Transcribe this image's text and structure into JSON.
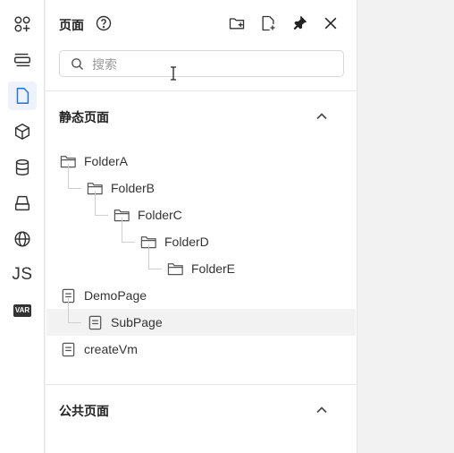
{
  "panel": {
    "title": "页面",
    "header_icons": [
      "help-circle-icon",
      "new-folder-icon",
      "new-page-icon",
      "pin-icon",
      "close-icon"
    ]
  },
  "search": {
    "placeholder": "搜索",
    "value": ""
  },
  "sections": {
    "static": {
      "title": "静态页面",
      "expanded": true
    },
    "public": {
      "title": "公共页面",
      "expanded": true
    }
  },
  "tree": [
    {
      "label": "FolderA",
      "type": "folder",
      "depth": 0
    },
    {
      "label": "FolderB",
      "type": "folder",
      "depth": 1
    },
    {
      "label": "FolderC",
      "type": "folder",
      "depth": 2
    },
    {
      "label": "FolderD",
      "type": "folder",
      "depth": 3
    },
    {
      "label": "FolderE",
      "type": "folder",
      "depth": 4
    },
    {
      "label": "DemoPage",
      "type": "page",
      "depth": 0
    },
    {
      "label": "SubPage",
      "type": "page",
      "depth": 1,
      "highlighted": true
    },
    {
      "label": "createVm",
      "type": "page",
      "depth": 0
    }
  ],
  "rail": [
    {
      "icon": "components-icon",
      "active": false
    },
    {
      "icon": "outline-tree-icon",
      "active": false
    },
    {
      "icon": "page-icon",
      "active": true
    },
    {
      "icon": "cube-icon",
      "active": false
    },
    {
      "icon": "database-icon",
      "active": false
    },
    {
      "icon": "stack-icon",
      "active": false
    },
    {
      "icon": "globe-icon",
      "active": false
    },
    {
      "icon": "js-icon",
      "label": "JS",
      "active": false
    },
    {
      "icon": "var-icon",
      "label": "VAR",
      "active": false
    }
  ],
  "colors": {
    "accent": "#1a73e8",
    "icon": "#333333"
  }
}
